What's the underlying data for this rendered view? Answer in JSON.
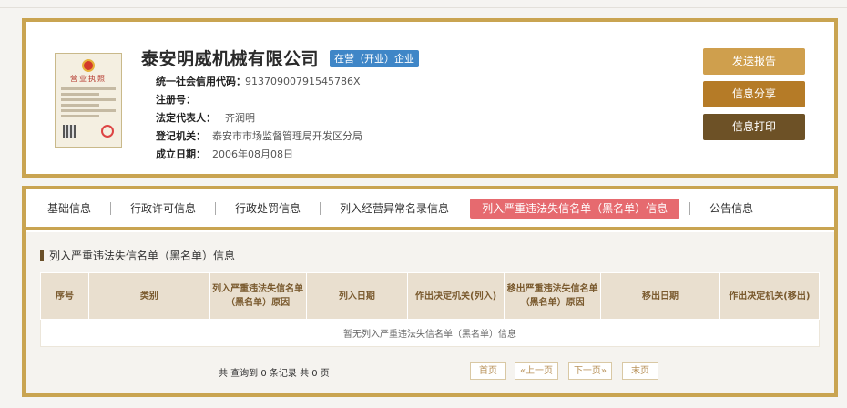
{
  "company": {
    "name": "泰安明威机械有限公司",
    "status": "在营（开业）企业",
    "license_text": "营业执照",
    "fields": [
      {
        "label": "统一社会信用代码：",
        "value": "91370900791545786X"
      },
      {
        "label": "注册号：",
        "value": ""
      },
      {
        "label": "法定代表人：",
        "value": "齐润明"
      },
      {
        "label": "登记机关：",
        "value": "泰安市市场监督管理局开发区分局"
      },
      {
        "label": "成立日期：",
        "value": "2006年08月08日"
      }
    ]
  },
  "actions": {
    "send_report": "发送报告",
    "share": "信息分享",
    "print": "信息打印"
  },
  "tabs": [
    {
      "label": "基础信息"
    },
    {
      "label": "行政许可信息"
    },
    {
      "label": "行政处罚信息"
    },
    {
      "label": "列入经营异常名录信息"
    },
    {
      "label": "列入严重违法失信名单（黑名单）信息"
    },
    {
      "label": "公告信息"
    }
  ],
  "section": {
    "title": "列入严重违法失信名单（黑名单）信息",
    "columns": [
      "序号",
      "类别",
      "列入严重违法失信名单（黑名单）原因",
      "列入日期",
      "作出决定机关(列入)",
      "移出严重违法失信名单（黑名单）原因",
      "移出日期",
      "作出决定机关(移出)"
    ],
    "empty_message": "暂无列入严重违法失信名单（黑名单）信息"
  },
  "pagination": {
    "summary": "共 查询到 0 条记录 共 0 页",
    "first": "首页",
    "prev": "«上一页",
    "next": "下一页»",
    "last": "末页"
  },
  "colors": {
    "gold_border": "#c9a451",
    "active_tab": "#e66a6f",
    "status_badge": "#3f86c7"
  }
}
